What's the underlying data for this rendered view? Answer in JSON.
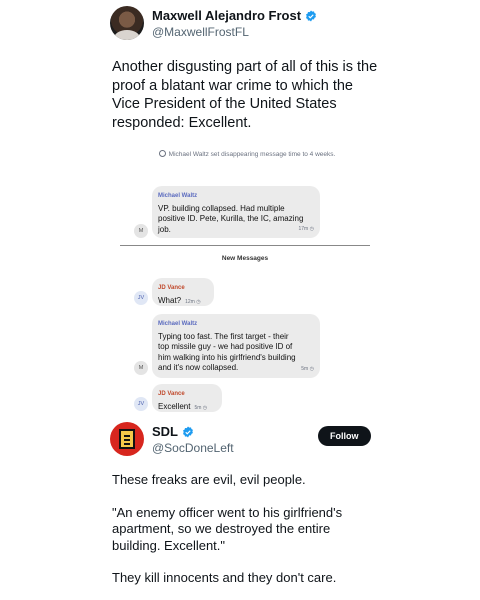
{
  "tweet1": {
    "author": {
      "name": "Maxwell Alejandro Frost",
      "handle": "@MaxwellFrostFL"
    },
    "text": "Another disgusting part of all of this is the proof a blatant war crime to which the Vice President of the United States responded: Excellent."
  },
  "chat": {
    "system_message": "Michael Waltz set disappearing message time to 4 weeks.",
    "new_messages_label": "New Messages",
    "messages": [
      {
        "avatar": "M",
        "sender": "Michael Waltz",
        "text": "VP.  building collapsed. Had multiple positive ID. Pete, Kurilla, the IC, amazing job.",
        "time": "17m"
      },
      {
        "avatar": "JV",
        "sender": "JD Vance",
        "text": "What?",
        "time": "12m"
      },
      {
        "avatar": "M",
        "sender": "Michael Waltz",
        "text": "Typing too fast. The first target - their top missile guy - we had positive ID of him walking into his girlfriend's building and it's now collapsed.",
        "time": "5m"
      },
      {
        "avatar": "JV",
        "sender": "JD Vance",
        "text": "Excellent",
        "time": "5m"
      }
    ],
    "colors": {
      "bubble": "#ebebeb",
      "waltz": "#5b6bbf",
      "vance": "#c0492c"
    }
  },
  "tweet2": {
    "author": {
      "name": "SDL",
      "handle": "@SocDoneLeft"
    },
    "follow_label": "Follow",
    "paragraphs": [
      "These freaks are evil, evil people.",
      "\"An enemy officer went to his girlfriend's apartment, so we destroyed the entire building. Excellent.\"",
      "They kill innocents and they don't care."
    ]
  },
  "icons": {
    "verified": "verified-badge-icon",
    "clock": "clock-icon"
  },
  "colors": {
    "verified": "#1d9bf0",
    "text": "#0f1419",
    "secondary": "#536471"
  }
}
